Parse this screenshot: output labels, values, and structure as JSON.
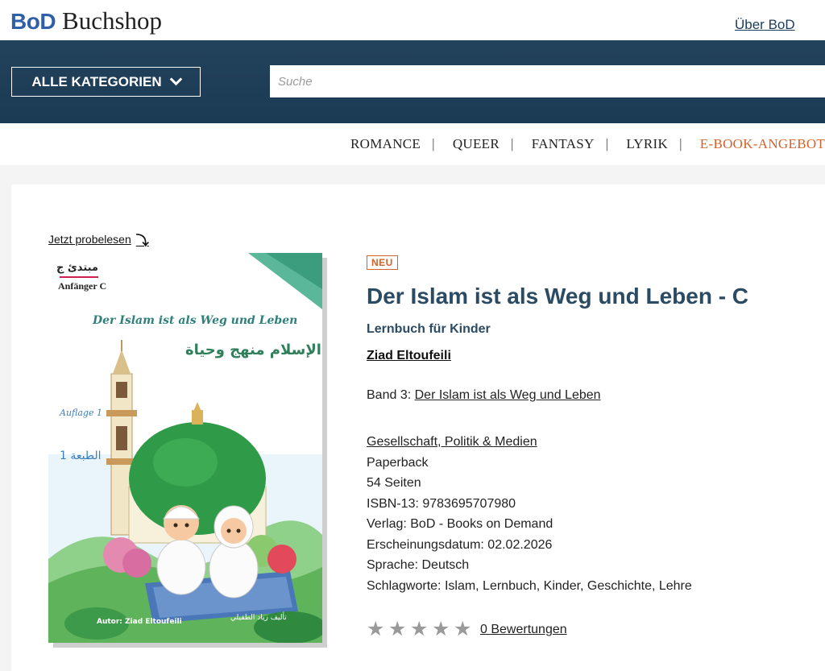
{
  "brand": {
    "logo_primary": "BoD",
    "logo_secondary": "Buchshop",
    "brand_color": "#2f5fa8"
  },
  "topbar": {
    "about_label": "Über BoD"
  },
  "header": {
    "categories_label": "ALLE KATEGORIEN",
    "search_placeholder": "Suche",
    "bg_color": "#1f3e58"
  },
  "genres": {
    "items": [
      "ROMANCE",
      "QUEER",
      "FANTASY",
      "LYRIK",
      "E-BOOK-ANGEBOTE"
    ],
    "separator": "|",
    "highlight_color": "#d4622a"
  },
  "product": {
    "preview_label": "Jetzt probelesen",
    "badge": "NEU",
    "title": "Der Islam ist als Weg und Leben - C",
    "subtitle": "Lernbuch für Kinder",
    "author": "Ziad Eltoufeili",
    "series_prefix": "Band 3:",
    "series_link": "Der Islam ist als Weg und Leben",
    "category": "Gesellschaft, Politik & Medien",
    "format": "Paperback",
    "pages": "54 Seiten",
    "isbn": "ISBN-13: 9783695707980",
    "publisher": "Verlag: BoD - Books on Demand",
    "release": "Erscheinungsdatum: 02.02.2026",
    "language": "Sprache: Deutsch",
    "keywords": "Schlagworte: Islam, Lernbuch, Kinder, Geschichte, Lehre",
    "rating_stars": 0,
    "rating_max": 5,
    "rating_label": "0 Bewertungen"
  },
  "cover": {
    "level_arabic": "مبتدئ ج",
    "level_label": "Anfänger C",
    "title_de": "Der Islam ist als Weg und Leben",
    "title_ar": "الإسلام منهج وحياة",
    "edition_de": "Auflage 1",
    "edition_ar": "الطبعة 1",
    "author_label": "Autor: Ziad Eltoufeili",
    "author_ar": "تأليف زياد الطفيلي"
  }
}
